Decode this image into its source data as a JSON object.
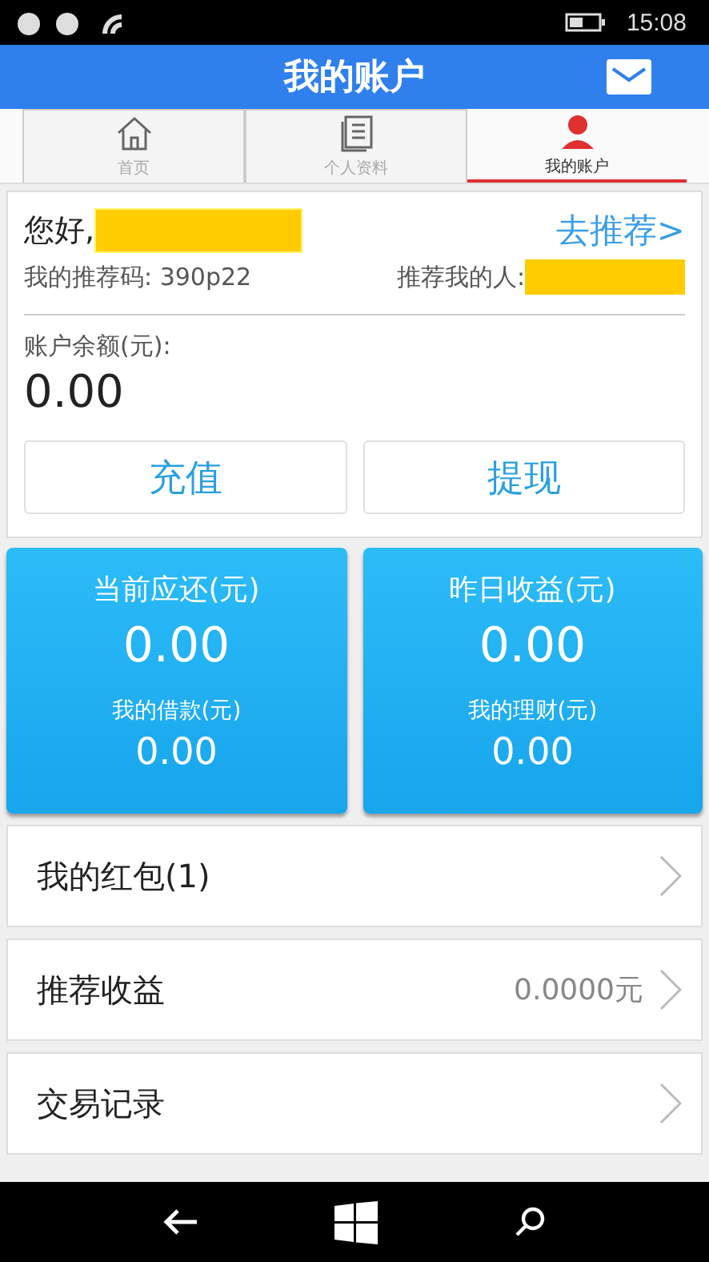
{
  "status_bar": {
    "time": "15:08"
  },
  "header": {
    "title": "我的账户"
  },
  "tabs": [
    {
      "label": "首页",
      "kind": "home",
      "selected": false
    },
    {
      "label": "个人资料",
      "kind": "doc",
      "selected": false
    },
    {
      "label": "我的账户",
      "kind": "person",
      "selected": true
    }
  ],
  "account": {
    "greeting": "您好,",
    "recommend_link": "去推荐>",
    "my_code": "我的推荐码: 390p22",
    "referrer_label": "推荐我的人:",
    "balance_label": "账户余额(元):",
    "balance": "0.00",
    "buttons": [
      "充值",
      "提现"
    ]
  },
  "summary_cards": [
    {
      "title": "当前应还(元)",
      "value": "0.00",
      "sub_label": "我的借款(元)",
      "sub_value": "0.00"
    },
    {
      "title": "昨日收益(元)",
      "value": "0.00",
      "sub_label": "我的理财(元)",
      "sub_value": "0.00"
    }
  ],
  "menu": [
    {
      "label": "我的红包(1)"
    },
    {
      "label": "推荐收益",
      "value": "0.0000元"
    },
    {
      "label": "交易记录"
    }
  ]
}
